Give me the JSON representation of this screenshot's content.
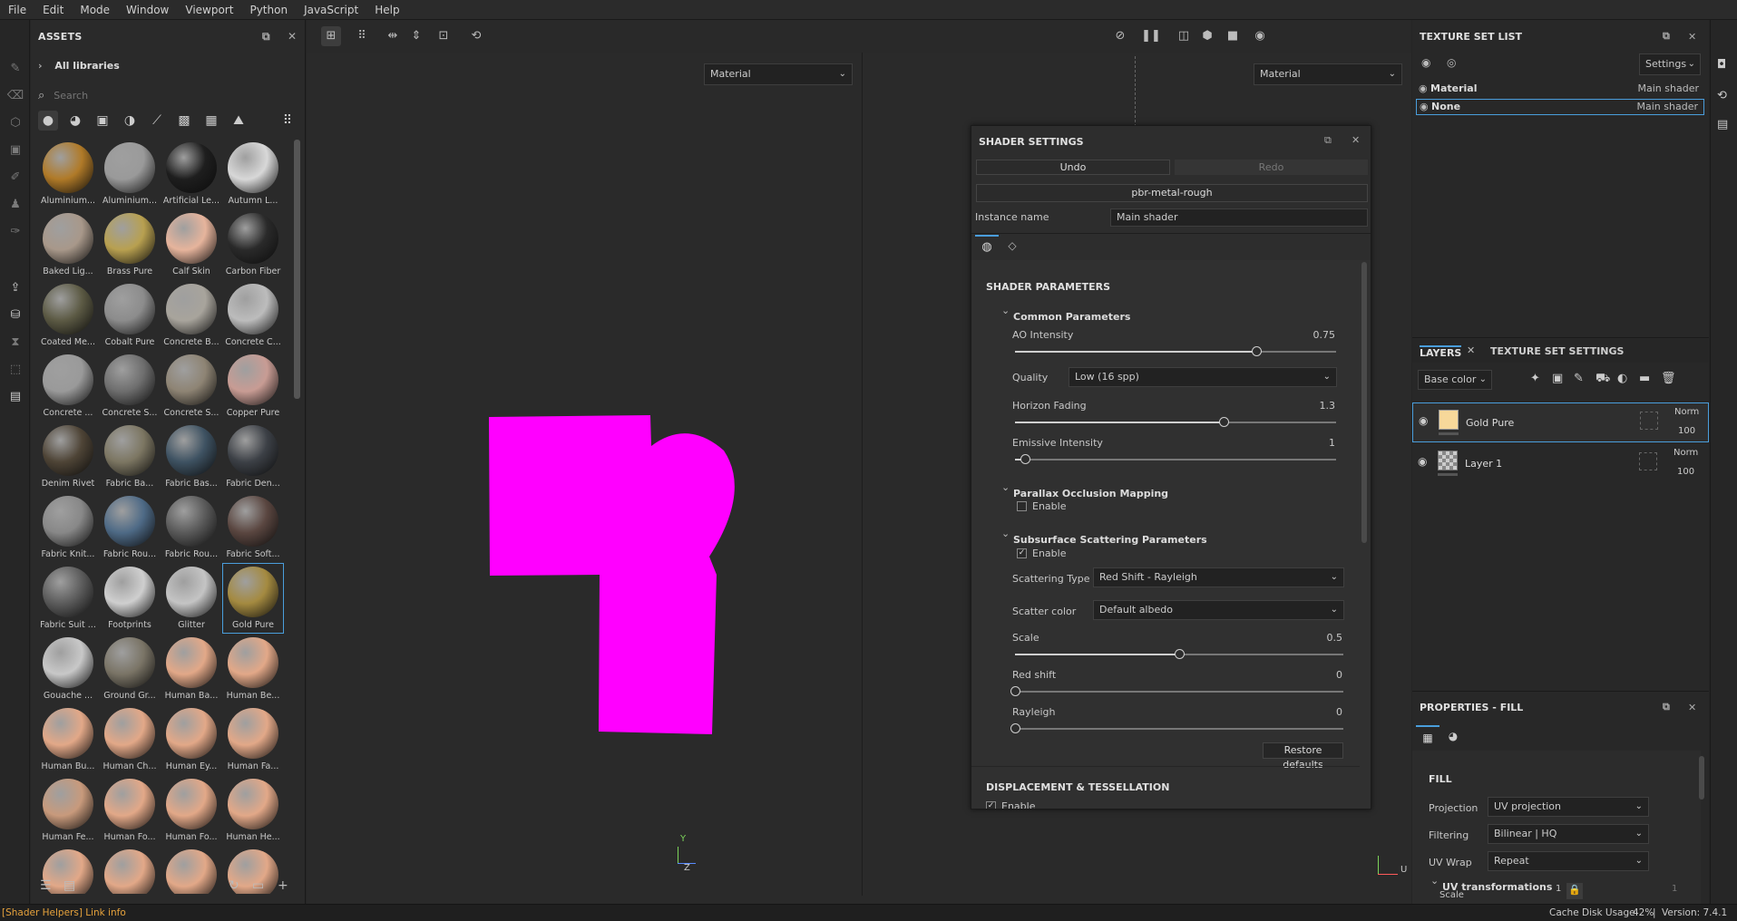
{
  "menu": [
    "File",
    "Edit",
    "Mode",
    "Window",
    "Viewport",
    "Python",
    "JavaScript",
    "Help"
  ],
  "assets": {
    "title": "ASSETS",
    "breadcrumb": "All libraries",
    "search_placeholder": "Search",
    "items": [
      {
        "label": "Aluminium...",
        "color": "#b07a28"
      },
      {
        "label": "Aluminium...",
        "color": "#9a9a9a"
      },
      {
        "label": "Artificial Le...",
        "color": "#1e1e1e"
      },
      {
        "label": "Autumn L...",
        "color": "#d8d8d8"
      },
      {
        "label": "Baked Lig...",
        "color": "#a8988a"
      },
      {
        "label": "Brass Pure",
        "color": "#b8a050"
      },
      {
        "label": "Calf Skin",
        "color": "#e6b49c"
      },
      {
        "label": "Carbon Fiber",
        "color": "#2a2a2a"
      },
      {
        "label": "Coated Me...",
        "color": "#5c5a44"
      },
      {
        "label": "Cobalt Pure",
        "color": "#8c8c8c"
      },
      {
        "label": "Concrete B...",
        "color": "#a8a49c"
      },
      {
        "label": "Concrete C...",
        "color": "#bcbcbc"
      },
      {
        "label": "Concrete ...",
        "color": "#9a9a9a"
      },
      {
        "label": "Concrete S...",
        "color": "#6e6e6e"
      },
      {
        "label": "Concrete S...",
        "color": "#8e8474"
      },
      {
        "label": "Copper Pure",
        "color": "#c89c94"
      },
      {
        "label": "Denim Rivet",
        "color": "#4e4436"
      },
      {
        "label": "Fabric Ba...",
        "color": "#7c7662"
      },
      {
        "label": "Fabric Bas...",
        "color": "#3e5262"
      },
      {
        "label": "Fabric Den...",
        "color": "#3c4046"
      },
      {
        "label": "Fabric Knit...",
        "color": "#888888"
      },
      {
        "label": "Fabric Rou...",
        "color": "#4e6a86"
      },
      {
        "label": "Fabric Rou...",
        "color": "#5a5a5a"
      },
      {
        "label": "Fabric Soft...",
        "color": "#5a4640"
      },
      {
        "label": "Fabric Suit ...",
        "color": "#5c5c5c"
      },
      {
        "label": "Footprints",
        "color": "#cfcfcf"
      },
      {
        "label": "Glitter",
        "color": "#c4c4c4"
      },
      {
        "label": "Gold Pure",
        "color": "#a48a40"
      },
      {
        "label": "Gouache ...",
        "color": "#c8c8c8"
      },
      {
        "label": "Ground Gr...",
        "color": "#7a7466"
      },
      {
        "label": "Human Ba...",
        "color": "#e2a888"
      },
      {
        "label": "Human Be...",
        "color": "#e2a888"
      },
      {
        "label": "Human Bu...",
        "color": "#e2a888"
      },
      {
        "label": "Human Ch...",
        "color": "#e2a888"
      },
      {
        "label": "Human Ey...",
        "color": "#e2a888"
      },
      {
        "label": "Human Fa...",
        "color": "#e2a888"
      },
      {
        "label": "Human Fe...",
        "color": "#c89a7c"
      },
      {
        "label": "Human Fo...",
        "color": "#e2a888"
      },
      {
        "label": "Human Fo...",
        "color": "#e2a888"
      },
      {
        "label": "Human He...",
        "color": "#e2a888"
      },
      {
        "label": "",
        "color": "#e2a888"
      },
      {
        "label": "",
        "color": "#e2a888"
      },
      {
        "label": "",
        "color": "#e2a888"
      },
      {
        "label": "",
        "color": "#e2a888"
      }
    ]
  },
  "viewport": {
    "left_mode": "Material",
    "right_mode": "Material",
    "axis_left": {
      "y": "Y",
      "z": "Z"
    },
    "axis_right": {
      "u": "U"
    }
  },
  "shader": {
    "title": "SHADER SETTINGS",
    "undo": "Undo",
    "redo": "Redo",
    "shader_name": "pbr-metal-rough",
    "instance_label": "Instance name",
    "instance_value": "Main shader",
    "section": "SHADER PARAMETERS",
    "common": {
      "title": "Common Parameters",
      "ao_label": "AO Intensity",
      "ao_value": "0.75",
      "ao_fraction": 0.75,
      "quality_label": "Quality",
      "quality_value": "Low (16 spp)",
      "horizon_label": "Horizon Fading",
      "horizon_value": "1.3",
      "horizon_fraction": 0.65,
      "emissive_label": "Emissive Intensity",
      "emissive_value": "1",
      "emissive_fraction": 0.03
    },
    "parallax": {
      "title": "Parallax Occlusion Mapping",
      "enable_label": "Enable",
      "enabled": false
    },
    "sss": {
      "title": "Subsurface Scattering Parameters",
      "enable_label": "Enable",
      "enabled": true,
      "type_label": "Scattering Type",
      "type_value": "Red Shift - Rayleigh",
      "color_label": "Scatter color",
      "color_value": "Default albedo",
      "scale_label": "Scale",
      "scale_value": "0.5",
      "scale_fraction": 0.5,
      "red_label": "Red shift",
      "red_value": "0",
      "red_fraction": 0.0,
      "rayleigh_label": "Rayleigh",
      "rayleigh_value": "0",
      "rayleigh_fraction": 0.0
    },
    "restore": "Restore defaults",
    "displacement": "DISPLACEMENT & TESSELLATION",
    "disp_enable": "Enable"
  },
  "texture_set_list": {
    "title": "TEXTURE SET LIST",
    "settings": "Settings",
    "rows": [
      {
        "name": "Material",
        "shader": "Main shader"
      },
      {
        "name": "None",
        "shader": "Main shader"
      }
    ]
  },
  "layers": {
    "tab_layers": "LAYERS",
    "tab_tss": "TEXTURE SET SETTINGS",
    "channel": "Base color",
    "rows": [
      {
        "name": "Gold Pure",
        "blend": "Norm",
        "opacity": "100"
      },
      {
        "name": "Layer 1",
        "blend": "Norm",
        "opacity": "100"
      }
    ]
  },
  "properties": {
    "title": "PROPERTIES - FILL",
    "section": "FILL",
    "projection_label": "Projection",
    "projection_value": "UV projection",
    "filtering_label": "Filtering",
    "filtering_value": "Bilinear | HQ",
    "uvwrap_label": "UV Wrap",
    "uvwrap_value": "Repeat",
    "uvt_title": "UV transformations",
    "scale_label": "Scale",
    "scale_value": "1",
    "scale_value2": "1"
  },
  "status": {
    "left": "[Shader Helpers] Link info",
    "cache_label": "Cache Disk Usage:",
    "cache_value": "42%",
    "version": "Version: 7.4.1"
  },
  "colors": {
    "accent": "#4a9edc",
    "magenta": "#ff00ff",
    "status_link": "#e6a23c"
  }
}
